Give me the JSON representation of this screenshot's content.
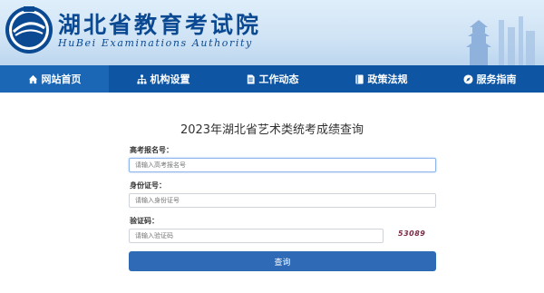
{
  "header": {
    "site_title": "湖北省教育考试院",
    "site_subtitle": "HuBei Examinations Authority"
  },
  "nav": {
    "items": [
      {
        "label": "网站首页",
        "icon": "home-icon"
      },
      {
        "label": "机构设置",
        "icon": "org-chart-icon"
      },
      {
        "label": "工作动态",
        "icon": "document-icon"
      },
      {
        "label": "政策法规",
        "icon": "book-icon"
      },
      {
        "label": "服务指南",
        "icon": "compass-icon"
      }
    ]
  },
  "form": {
    "title": "2023年湖北省艺术类统考成绩查询",
    "exam_number_label": "高考报名号：",
    "exam_number_placeholder": "请输入高考报名号",
    "id_label": "身份证号：",
    "id_placeholder": "请输入身份证号",
    "captcha_label": "验证码：",
    "captcha_placeholder": "请输入验证码",
    "captcha_text": "53089",
    "submit_label": "查询"
  },
  "colors": {
    "nav_bg": "#0e56a4",
    "button_bg": "#2f6ab6",
    "title_blue": "#0b4a93"
  }
}
